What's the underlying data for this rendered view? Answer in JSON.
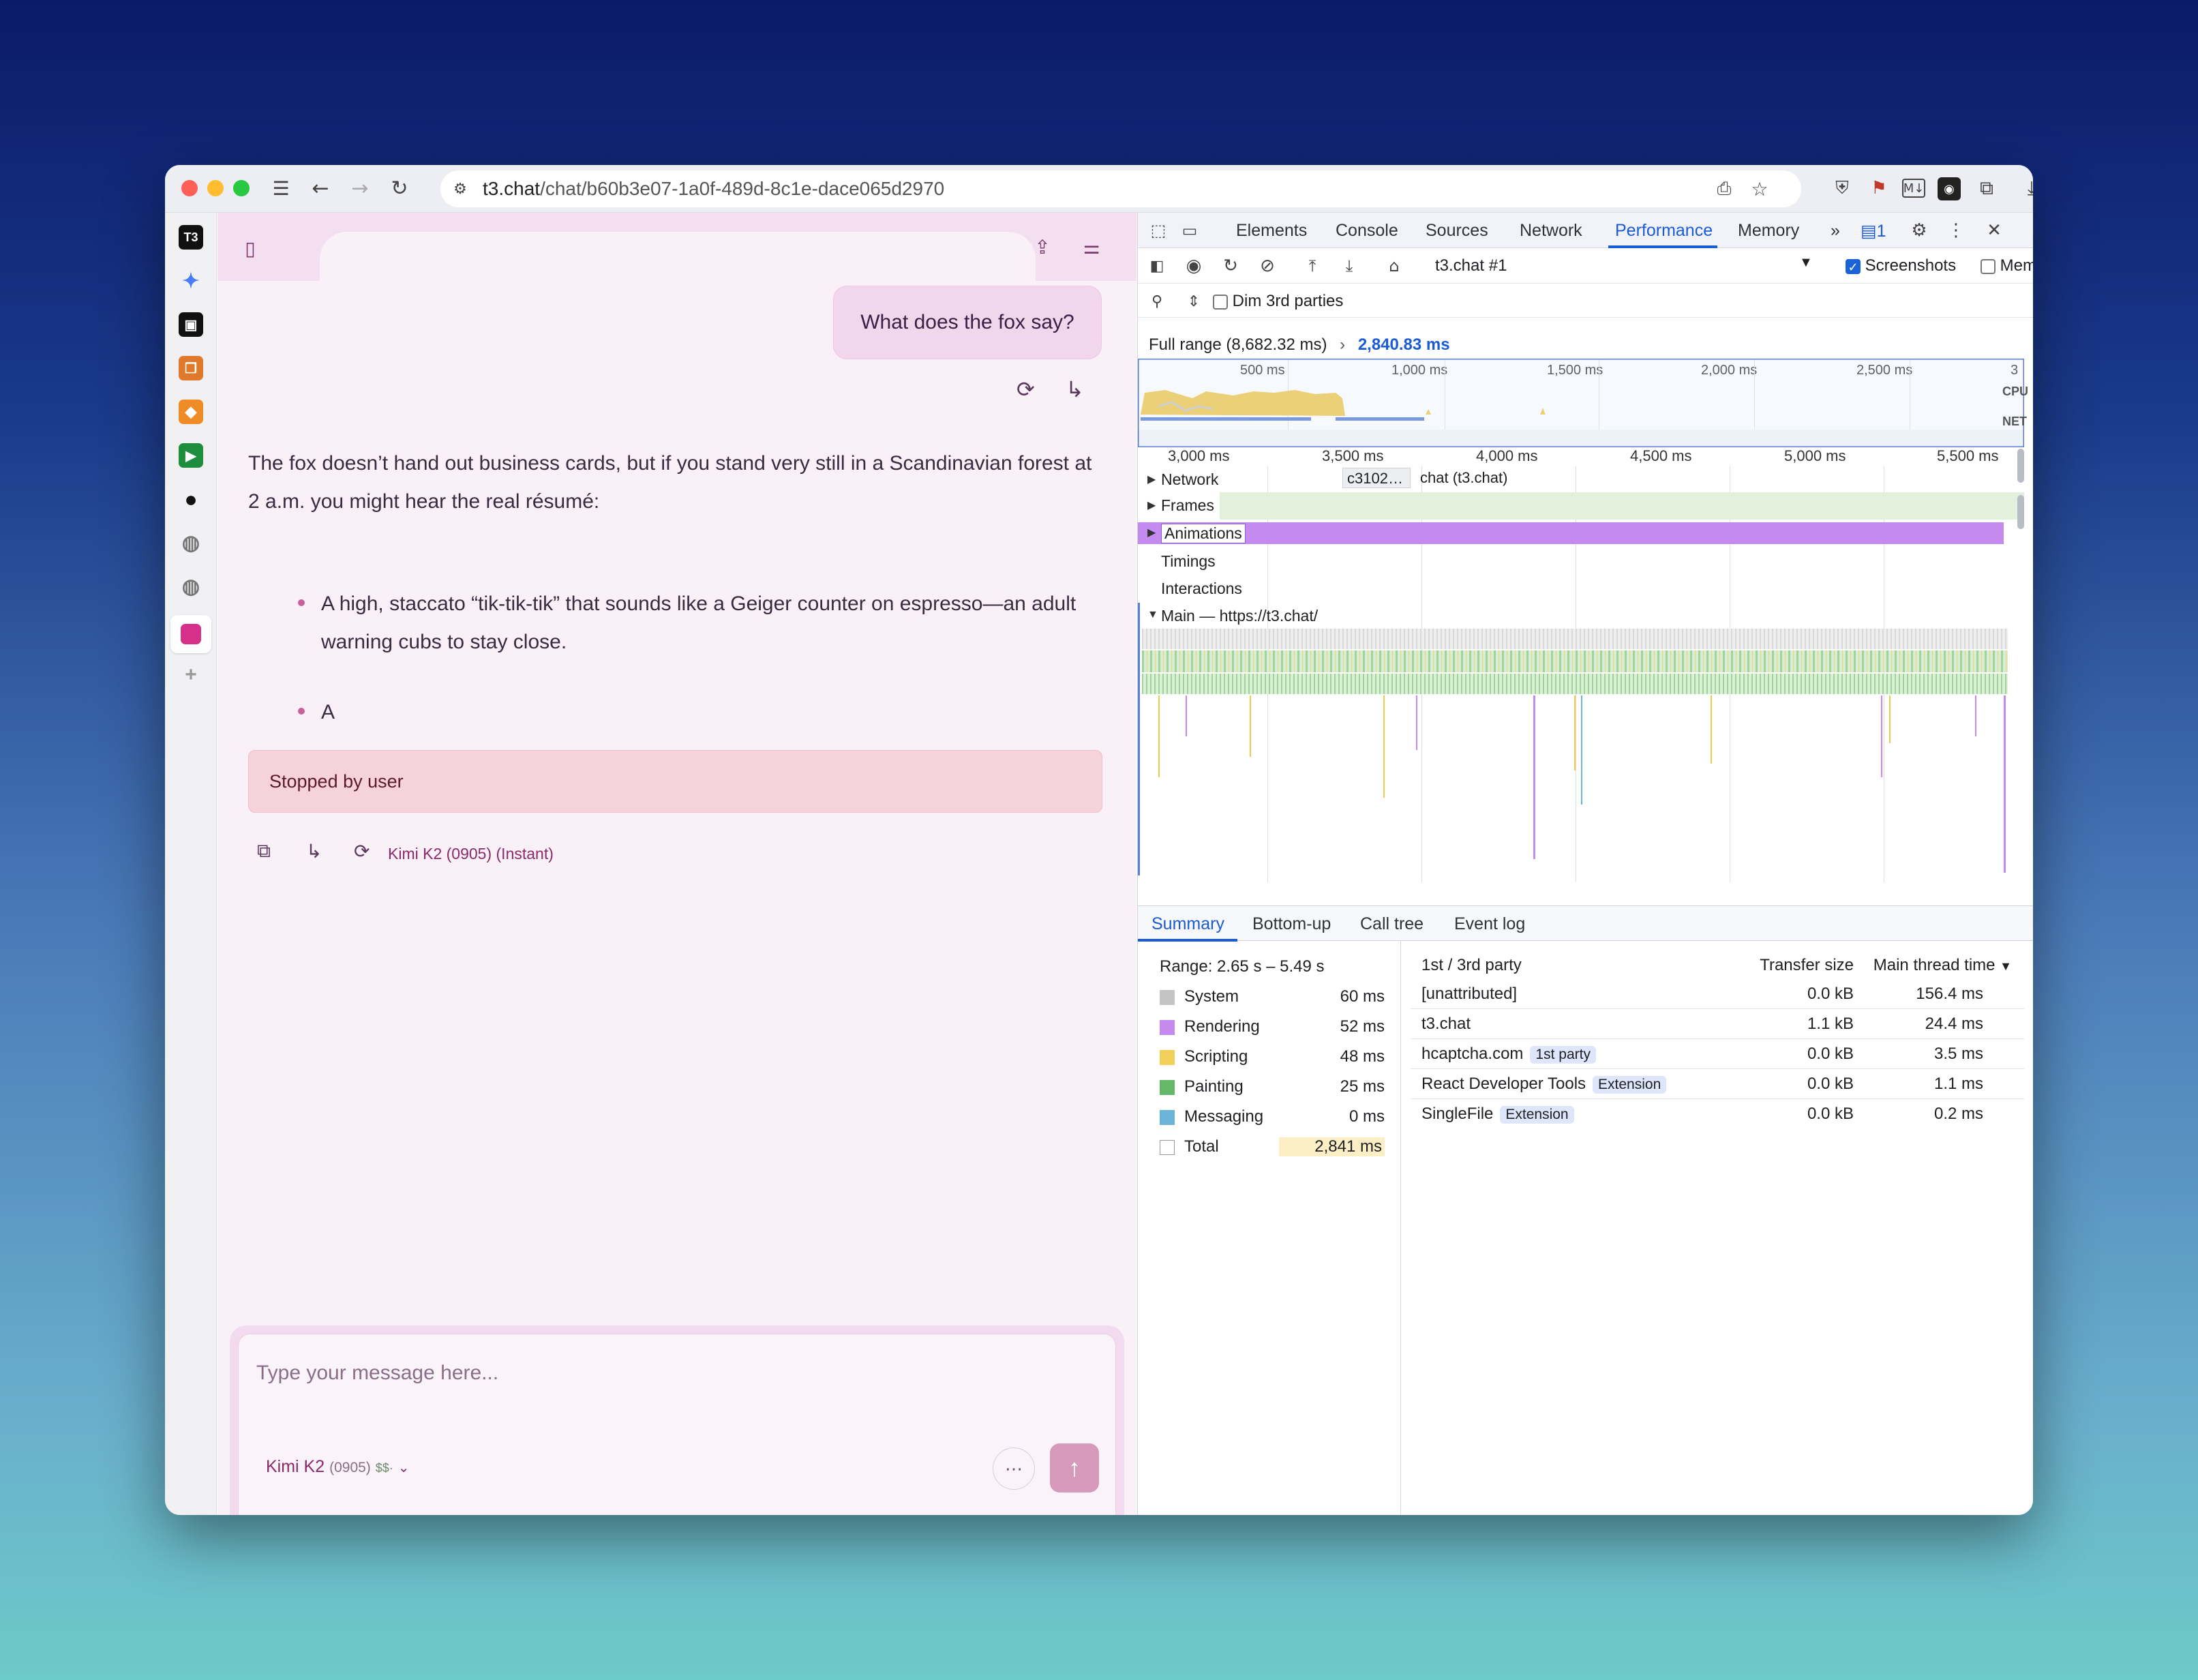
{
  "browser": {
    "url_host": "t3.chat",
    "url_path": "/chat/b60b3e07-1a0f-489d-8c1e-dace065d2970"
  },
  "sidebar": {
    "items": [
      {
        "name": "t3-app",
        "label": "T3"
      },
      {
        "name": "gemini-app"
      },
      {
        "name": "app-3"
      },
      {
        "name": "app-4"
      },
      {
        "name": "app-5"
      },
      {
        "name": "google-meet-app"
      },
      {
        "name": "github-app"
      },
      {
        "name": "globe-app-1"
      },
      {
        "name": "globe-app-2"
      },
      {
        "name": "active-app"
      }
    ]
  },
  "chat": {
    "user_message": "What does the fox say?",
    "response_intro": "The fox doesn’t hand out business cards, but if you stand very still in a Scandinavian forest at 2 a.m. you might hear the real résumé:",
    "bullets": [
      "A high, staccato “tik-tik-tik” that sounds like a Geiger counter on espresso—an adult warning cubs to stay close.",
      "A"
    ],
    "bullet1_line1": "A high, staccato “tik-tik-tik” that sounds like a Geiger counter on espresso—an adult",
    "bullet1_line2": "warning cubs to stay close.",
    "stopped_text": "Stopped by user",
    "model_label": "Kimi K2 (0905)",
    "model_mode": "(Instant)",
    "input_placeholder": "Type your message here...",
    "model_selector": {
      "name": "Kimi K2",
      "version": "(0905)",
      "price": "$$·"
    }
  },
  "devtools": {
    "tabs": [
      "Elements",
      "Console",
      "Sources",
      "Network",
      "Performance",
      "Memory"
    ],
    "active_tab": "Performance",
    "issues_count": "1",
    "recording_select": "t3.chat #1",
    "screenshots_label": "Screenshots",
    "memory_label": "Memory",
    "dim_label": "Dim 3rd parties",
    "full_range": "Full range (8,682.32 ms)",
    "selected_range": "2,840.83 ms",
    "overview_ticks": [
      "500 ms",
      "1,000 ms",
      "1,500 ms",
      "2,000 ms",
      "2,500 ms",
      "3"
    ],
    "overview_labels": {
      "cpu": "CPU",
      "net": "NET"
    },
    "timeline_ticks": [
      "3,000 ms",
      "3,500 ms",
      "4,000 ms",
      "4,500 ms",
      "5,000 ms",
      "5,500 ms"
    ],
    "tracks": {
      "network": "Network",
      "network_item1": "c3102…",
      "network_item2": "chat (t3.chat)",
      "frames": "Frames",
      "animations": "Animations",
      "timings": "Timings",
      "interactions": "Interactions",
      "main": "Main — https://t3.chat/"
    },
    "bottom_tabs": [
      "Summary",
      "Bottom-up",
      "Call tree",
      "Event log"
    ],
    "summary": {
      "range": "Range: 2.65 s – 5.49 s",
      "legend": [
        {
          "label": "System",
          "value": "60 ms",
          "color": "#c4c4c4"
        },
        {
          "label": "Rendering",
          "value": "52 ms",
          "color": "#c58af0"
        },
        {
          "label": "Scripting",
          "value": "48 ms",
          "color": "#f2cf5a"
        },
        {
          "label": "Painting",
          "value": "25 ms",
          "color": "#63b86a"
        },
        {
          "label": "Messaging",
          "value": "0 ms",
          "color": "#6ab4d8"
        },
        {
          "label": "Total",
          "value": "2,841 ms",
          "color": "#ffffff"
        }
      ]
    },
    "party_table": {
      "headers": [
        "1st / 3rd party",
        "Transfer size",
        "Main thread time"
      ],
      "rows": [
        {
          "name": "[unattributed]",
          "badge": "",
          "size": "0.0 kB",
          "time": "156.4 ms"
        },
        {
          "name": "t3.chat",
          "badge": "",
          "size": "1.1 kB",
          "time": "24.4 ms"
        },
        {
          "name": "hcaptcha.com",
          "badge": "1st party",
          "size": "0.0 kB",
          "time": "3.5 ms"
        },
        {
          "name": "React Developer Tools",
          "badge": "Extension",
          "size": "0.0 kB",
          "time": "1.1 ms"
        },
        {
          "name": "SingleFile",
          "badge": "Extension",
          "size": "0.0 kB",
          "time": "0.2 ms"
        }
      ]
    }
  }
}
